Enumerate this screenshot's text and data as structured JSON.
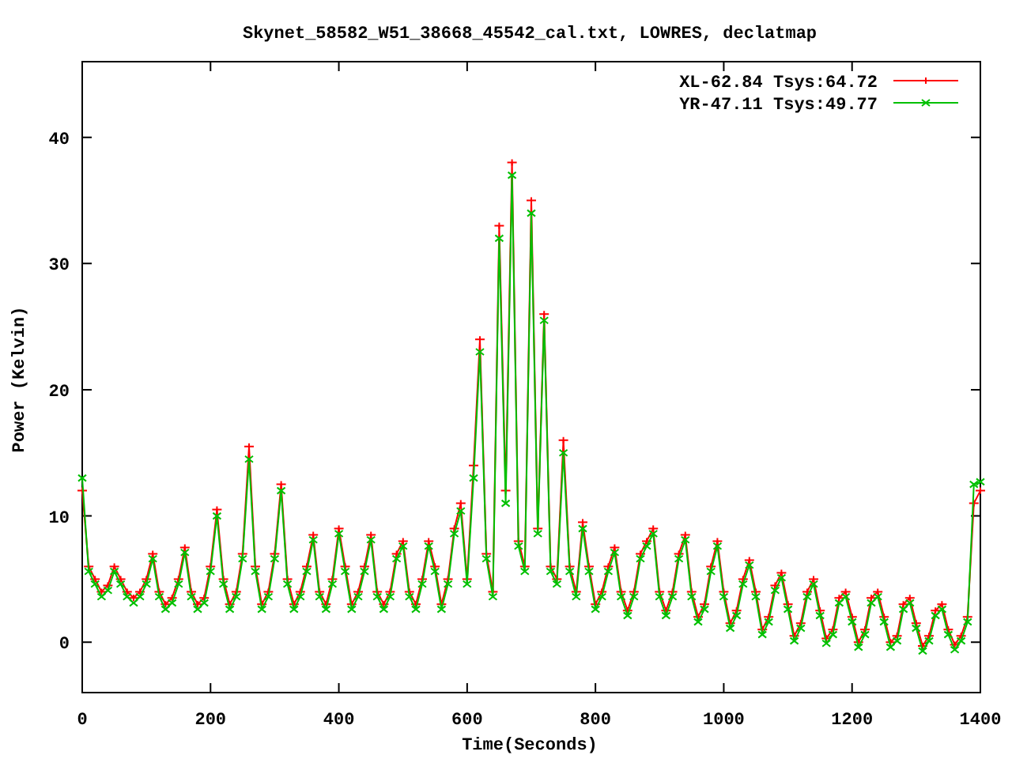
{
  "chart_data": {
    "type": "line",
    "title": "Skynet_58582_W51_38668_45542_cal.txt, LOWRES, declatmap",
    "xlabel": "Time(Seconds)",
    "ylabel": "Power (Kelvin)",
    "xlim": [
      0,
      1400
    ],
    "ylim": [
      -4,
      46
    ],
    "xticks": [
      0,
      200,
      400,
      600,
      800,
      1000,
      1200,
      1400
    ],
    "yticks": [
      0,
      10,
      20,
      30,
      40
    ],
    "legend": true,
    "x": [
      0,
      10,
      20,
      30,
      40,
      50,
      60,
      70,
      80,
      90,
      100,
      110,
      120,
      130,
      140,
      150,
      160,
      170,
      180,
      190,
      200,
      210,
      220,
      230,
      240,
      250,
      260,
      270,
      280,
      290,
      300,
      310,
      320,
      330,
      340,
      350,
      360,
      370,
      380,
      390,
      400,
      410,
      420,
      430,
      440,
      450,
      460,
      470,
      480,
      490,
      500,
      510,
      520,
      530,
      540,
      550,
      560,
      570,
      580,
      590,
      600,
      610,
      620,
      630,
      640,
      650,
      660,
      670,
      680,
      690,
      700,
      710,
      720,
      730,
      740,
      750,
      760,
      770,
      780,
      790,
      800,
      810,
      820,
      830,
      840,
      850,
      860,
      870,
      880,
      890,
      900,
      910,
      920,
      930,
      940,
      950,
      960,
      970,
      980,
      990,
      1000,
      1010,
      1020,
      1030,
      1040,
      1050,
      1060,
      1070,
      1080,
      1090,
      1100,
      1110,
      1120,
      1130,
      1140,
      1150,
      1160,
      1170,
      1180,
      1190,
      1200,
      1210,
      1220,
      1230,
      1240,
      1250,
      1260,
      1270,
      1280,
      1290,
      1300,
      1310,
      1320,
      1330,
      1340,
      1350,
      1360,
      1370,
      1380,
      1390,
      1400
    ],
    "series": [
      {
        "name": "XL-62.84 Tsys:64.72",
        "color": "#ff0000",
        "marker": "plus",
        "values": [
          12,
          6,
          5,
          4,
          4.5,
          6,
          5,
          4,
          3.5,
          4,
          5,
          7,
          4,
          3,
          3.5,
          5,
          7.5,
          4,
          3,
          3.5,
          6,
          10.5,
          5,
          3,
          4,
          7,
          15.5,
          6,
          3,
          4,
          7,
          12.5,
          5,
          3,
          4,
          6,
          8.5,
          4,
          3,
          5,
          9,
          6,
          3,
          4,
          6,
          8.5,
          4,
          3,
          4,
          7,
          8,
          4,
          3,
          5,
          8,
          6,
          3,
          5,
          9,
          11,
          5,
          14,
          24,
          7,
          4,
          33,
          12,
          38,
          8,
          6,
          35,
          9,
          26,
          6,
          5,
          16,
          6,
          4,
          9.5,
          6,
          3,
          4,
          6,
          7.5,
          4,
          2.5,
          4,
          7,
          8,
          9,
          4,
          2.5,
          4,
          7,
          8.5,
          4,
          2,
          3,
          6,
          8,
          4,
          1.5,
          2.5,
          5,
          6.5,
          4,
          1,
          2,
          4.5,
          5.5,
          3,
          0.5,
          1.5,
          4,
          5,
          2.5,
          0.3,
          1,
          3.5,
          4,
          2,
          0,
          1,
          3.5,
          4,
          2,
          0,
          0.5,
          3,
          3.5,
          1.5,
          -0.3,
          0.5,
          2.5,
          3,
          1,
          -0.2,
          0.5,
          2,
          11,
          12
        ]
      },
      {
        "name": "YR-47.11 Tsys:49.77",
        "color": "#00c000",
        "marker": "cross",
        "values": [
          13,
          5.6,
          4.6,
          3.6,
          4.1,
          5.6,
          4.6,
          3.6,
          3.1,
          3.6,
          4.6,
          6.6,
          3.6,
          2.6,
          3.1,
          4.6,
          7.1,
          3.6,
          2.6,
          3.1,
          5.6,
          10,
          4.6,
          2.6,
          3.6,
          6.6,
          14.5,
          5.6,
          2.6,
          3.6,
          6.6,
          12,
          4.6,
          2.6,
          3.6,
          5.6,
          8.1,
          3.6,
          2.6,
          4.6,
          8.6,
          5.6,
          2.6,
          3.6,
          5.6,
          8.1,
          3.6,
          2.6,
          3.6,
          6.6,
          7.6,
          3.6,
          2.6,
          4.6,
          7.6,
          5.6,
          2.6,
          4.6,
          8.6,
          10.4,
          4.6,
          13,
          23,
          6.6,
          3.6,
          32,
          11,
          37,
          7.6,
          5.6,
          34,
          8.6,
          25.5,
          5.6,
          4.6,
          15,
          5.6,
          3.6,
          9,
          5.6,
          2.6,
          3.6,
          5.6,
          7.1,
          3.6,
          2.1,
          3.6,
          6.6,
          7.6,
          8.6,
          3.6,
          2.1,
          3.6,
          6.6,
          8.1,
          3.6,
          1.6,
          2.6,
          5.6,
          7.6,
          3.6,
          1.1,
          2.1,
          4.6,
          6.1,
          3.6,
          0.6,
          1.6,
          4.1,
          5.1,
          2.6,
          0.1,
          1.1,
          3.6,
          4.6,
          2.1,
          -0.1,
          0.6,
          3.1,
          3.6,
          1.6,
          -0.4,
          0.6,
          3.1,
          3.6,
          1.6,
          -0.4,
          0.1,
          2.6,
          3.1,
          1.1,
          -0.7,
          0.1,
          2.1,
          2.6,
          0.6,
          -0.6,
          0.1,
          1.6,
          12.5,
          12.7
        ]
      }
    ]
  }
}
